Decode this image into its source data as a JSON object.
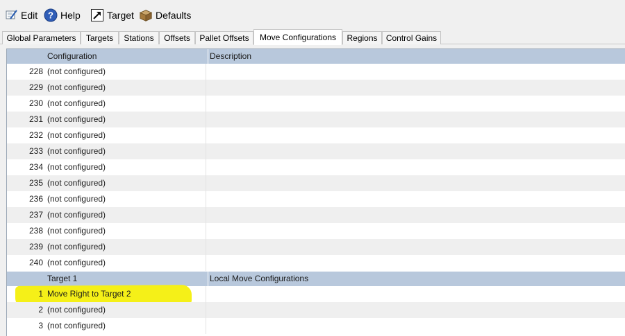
{
  "toolbar": {
    "edit_label": "Edit",
    "help_label": "Help",
    "target_label": "Target",
    "defaults_label": "Defaults"
  },
  "tabs": [
    {
      "label": "Global Parameters",
      "active": false
    },
    {
      "label": "Targets",
      "active": false
    },
    {
      "label": "Stations",
      "active": false
    },
    {
      "label": "Offsets",
      "active": false
    },
    {
      "label": "Pallet Offsets",
      "active": false
    },
    {
      "label": "Move Configurations",
      "active": true
    },
    {
      "label": "Regions",
      "active": false
    },
    {
      "label": "Control Gains",
      "active": false
    }
  ],
  "grid": {
    "sections": [
      {
        "header": {
          "col1": "Configuration",
          "col2": "Description"
        },
        "rows": [
          {
            "num": "228",
            "config": "(not configured)",
            "description": ""
          },
          {
            "num": "229",
            "config": "(not configured)",
            "description": ""
          },
          {
            "num": "230",
            "config": "(not configured)",
            "description": ""
          },
          {
            "num": "231",
            "config": "(not configured)",
            "description": ""
          },
          {
            "num": "232",
            "config": "(not configured)",
            "description": ""
          },
          {
            "num": "233",
            "config": "(not configured)",
            "description": ""
          },
          {
            "num": "234",
            "config": "(not configured)",
            "description": ""
          },
          {
            "num": "235",
            "config": "(not configured)",
            "description": ""
          },
          {
            "num": "236",
            "config": "(not configured)",
            "description": ""
          },
          {
            "num": "237",
            "config": "(not configured)",
            "description": ""
          },
          {
            "num": "238",
            "config": "(not configured)",
            "description": ""
          },
          {
            "num": "239",
            "config": "(not configured)",
            "description": ""
          },
          {
            "num": "240",
            "config": "(not configured)",
            "description": ""
          }
        ]
      },
      {
        "header": {
          "col1": "Target 1",
          "col2": "Local Move Configurations"
        },
        "rows": [
          {
            "num": "1",
            "config": "Move Right to Target 2",
            "description": "",
            "highlighted": true
          },
          {
            "num": "2",
            "config": "(not configured)",
            "description": ""
          },
          {
            "num": "3",
            "config": "(not configured)",
            "description": ""
          }
        ]
      }
    ]
  },
  "colors": {
    "header_bg": "#b8c8dc",
    "alt_row_bg": "#efefef",
    "highlight": "#f5f018"
  }
}
